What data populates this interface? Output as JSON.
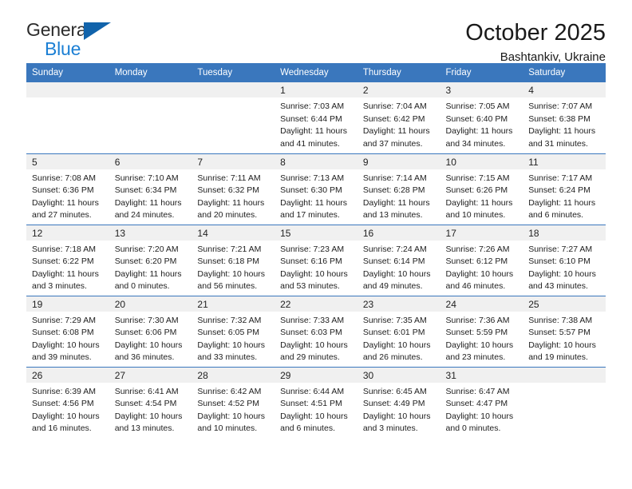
{
  "brand": {
    "name_top": "General",
    "name_bottom": "Blue"
  },
  "header": {
    "title": "October 2025",
    "location": "Bashtankiv, Ukraine"
  },
  "calendar": {
    "weekday_headers": [
      "Sunday",
      "Monday",
      "Tuesday",
      "Wednesday",
      "Thursday",
      "Friday",
      "Saturday"
    ],
    "accent_color": "#3a77bd",
    "daynum_background": "#f0f0f0",
    "weeks": [
      [
        {
          "day": "",
          "empty": true
        },
        {
          "day": "",
          "empty": true
        },
        {
          "day": "",
          "empty": true
        },
        {
          "day": "1",
          "sunrise": "Sunrise: 7:03 AM",
          "sunset": "Sunset: 6:44 PM",
          "daylight_line1": "Daylight: 11 hours",
          "daylight_line2": "and 41 minutes."
        },
        {
          "day": "2",
          "sunrise": "Sunrise: 7:04 AM",
          "sunset": "Sunset: 6:42 PM",
          "daylight_line1": "Daylight: 11 hours",
          "daylight_line2": "and 37 minutes."
        },
        {
          "day": "3",
          "sunrise": "Sunrise: 7:05 AM",
          "sunset": "Sunset: 6:40 PM",
          "daylight_line1": "Daylight: 11 hours",
          "daylight_line2": "and 34 minutes."
        },
        {
          "day": "4",
          "sunrise": "Sunrise: 7:07 AM",
          "sunset": "Sunset: 6:38 PM",
          "daylight_line1": "Daylight: 11 hours",
          "daylight_line2": "and 31 minutes."
        }
      ],
      [
        {
          "day": "5",
          "sunrise": "Sunrise: 7:08 AM",
          "sunset": "Sunset: 6:36 PM",
          "daylight_line1": "Daylight: 11 hours",
          "daylight_line2": "and 27 minutes."
        },
        {
          "day": "6",
          "sunrise": "Sunrise: 7:10 AM",
          "sunset": "Sunset: 6:34 PM",
          "daylight_line1": "Daylight: 11 hours",
          "daylight_line2": "and 24 minutes."
        },
        {
          "day": "7",
          "sunrise": "Sunrise: 7:11 AM",
          "sunset": "Sunset: 6:32 PM",
          "daylight_line1": "Daylight: 11 hours",
          "daylight_line2": "and 20 minutes."
        },
        {
          "day": "8",
          "sunrise": "Sunrise: 7:13 AM",
          "sunset": "Sunset: 6:30 PM",
          "daylight_line1": "Daylight: 11 hours",
          "daylight_line2": "and 17 minutes."
        },
        {
          "day": "9",
          "sunrise": "Sunrise: 7:14 AM",
          "sunset": "Sunset: 6:28 PM",
          "daylight_line1": "Daylight: 11 hours",
          "daylight_line2": "and 13 minutes."
        },
        {
          "day": "10",
          "sunrise": "Sunrise: 7:15 AM",
          "sunset": "Sunset: 6:26 PM",
          "daylight_line1": "Daylight: 11 hours",
          "daylight_line2": "and 10 minutes."
        },
        {
          "day": "11",
          "sunrise": "Sunrise: 7:17 AM",
          "sunset": "Sunset: 6:24 PM",
          "daylight_line1": "Daylight: 11 hours",
          "daylight_line2": "and 6 minutes."
        }
      ],
      [
        {
          "day": "12",
          "sunrise": "Sunrise: 7:18 AM",
          "sunset": "Sunset: 6:22 PM",
          "daylight_line1": "Daylight: 11 hours",
          "daylight_line2": "and 3 minutes."
        },
        {
          "day": "13",
          "sunrise": "Sunrise: 7:20 AM",
          "sunset": "Sunset: 6:20 PM",
          "daylight_line1": "Daylight: 11 hours",
          "daylight_line2": "and 0 minutes."
        },
        {
          "day": "14",
          "sunrise": "Sunrise: 7:21 AM",
          "sunset": "Sunset: 6:18 PM",
          "daylight_line1": "Daylight: 10 hours",
          "daylight_line2": "and 56 minutes."
        },
        {
          "day": "15",
          "sunrise": "Sunrise: 7:23 AM",
          "sunset": "Sunset: 6:16 PM",
          "daylight_line1": "Daylight: 10 hours",
          "daylight_line2": "and 53 minutes."
        },
        {
          "day": "16",
          "sunrise": "Sunrise: 7:24 AM",
          "sunset": "Sunset: 6:14 PM",
          "daylight_line1": "Daylight: 10 hours",
          "daylight_line2": "and 49 minutes."
        },
        {
          "day": "17",
          "sunrise": "Sunrise: 7:26 AM",
          "sunset": "Sunset: 6:12 PM",
          "daylight_line1": "Daylight: 10 hours",
          "daylight_line2": "and 46 minutes."
        },
        {
          "day": "18",
          "sunrise": "Sunrise: 7:27 AM",
          "sunset": "Sunset: 6:10 PM",
          "daylight_line1": "Daylight: 10 hours",
          "daylight_line2": "and 43 minutes."
        }
      ],
      [
        {
          "day": "19",
          "sunrise": "Sunrise: 7:29 AM",
          "sunset": "Sunset: 6:08 PM",
          "daylight_line1": "Daylight: 10 hours",
          "daylight_line2": "and 39 minutes."
        },
        {
          "day": "20",
          "sunrise": "Sunrise: 7:30 AM",
          "sunset": "Sunset: 6:06 PM",
          "daylight_line1": "Daylight: 10 hours",
          "daylight_line2": "and 36 minutes."
        },
        {
          "day": "21",
          "sunrise": "Sunrise: 7:32 AM",
          "sunset": "Sunset: 6:05 PM",
          "daylight_line1": "Daylight: 10 hours",
          "daylight_line2": "and 33 minutes."
        },
        {
          "day": "22",
          "sunrise": "Sunrise: 7:33 AM",
          "sunset": "Sunset: 6:03 PM",
          "daylight_line1": "Daylight: 10 hours",
          "daylight_line2": "and 29 minutes."
        },
        {
          "day": "23",
          "sunrise": "Sunrise: 7:35 AM",
          "sunset": "Sunset: 6:01 PM",
          "daylight_line1": "Daylight: 10 hours",
          "daylight_line2": "and 26 minutes."
        },
        {
          "day": "24",
          "sunrise": "Sunrise: 7:36 AM",
          "sunset": "Sunset: 5:59 PM",
          "daylight_line1": "Daylight: 10 hours",
          "daylight_line2": "and 23 minutes."
        },
        {
          "day": "25",
          "sunrise": "Sunrise: 7:38 AM",
          "sunset": "Sunset: 5:57 PM",
          "daylight_line1": "Daylight: 10 hours",
          "daylight_line2": "and 19 minutes."
        }
      ],
      [
        {
          "day": "26",
          "sunrise": "Sunrise: 6:39 AM",
          "sunset": "Sunset: 4:56 PM",
          "daylight_line1": "Daylight: 10 hours",
          "daylight_line2": "and 16 minutes."
        },
        {
          "day": "27",
          "sunrise": "Sunrise: 6:41 AM",
          "sunset": "Sunset: 4:54 PM",
          "daylight_line1": "Daylight: 10 hours",
          "daylight_line2": "and 13 minutes."
        },
        {
          "day": "28",
          "sunrise": "Sunrise: 6:42 AM",
          "sunset": "Sunset: 4:52 PM",
          "daylight_line1": "Daylight: 10 hours",
          "daylight_line2": "and 10 minutes."
        },
        {
          "day": "29",
          "sunrise": "Sunrise: 6:44 AM",
          "sunset": "Sunset: 4:51 PM",
          "daylight_line1": "Daylight: 10 hours",
          "daylight_line2": "and 6 minutes."
        },
        {
          "day": "30",
          "sunrise": "Sunrise: 6:45 AM",
          "sunset": "Sunset: 4:49 PM",
          "daylight_line1": "Daylight: 10 hours",
          "daylight_line2": "and 3 minutes."
        },
        {
          "day": "31",
          "sunrise": "Sunrise: 6:47 AM",
          "sunset": "Sunset: 4:47 PM",
          "daylight_line1": "Daylight: 10 hours",
          "daylight_line2": "and 0 minutes."
        },
        {
          "day": "",
          "empty": true
        }
      ]
    ]
  }
}
